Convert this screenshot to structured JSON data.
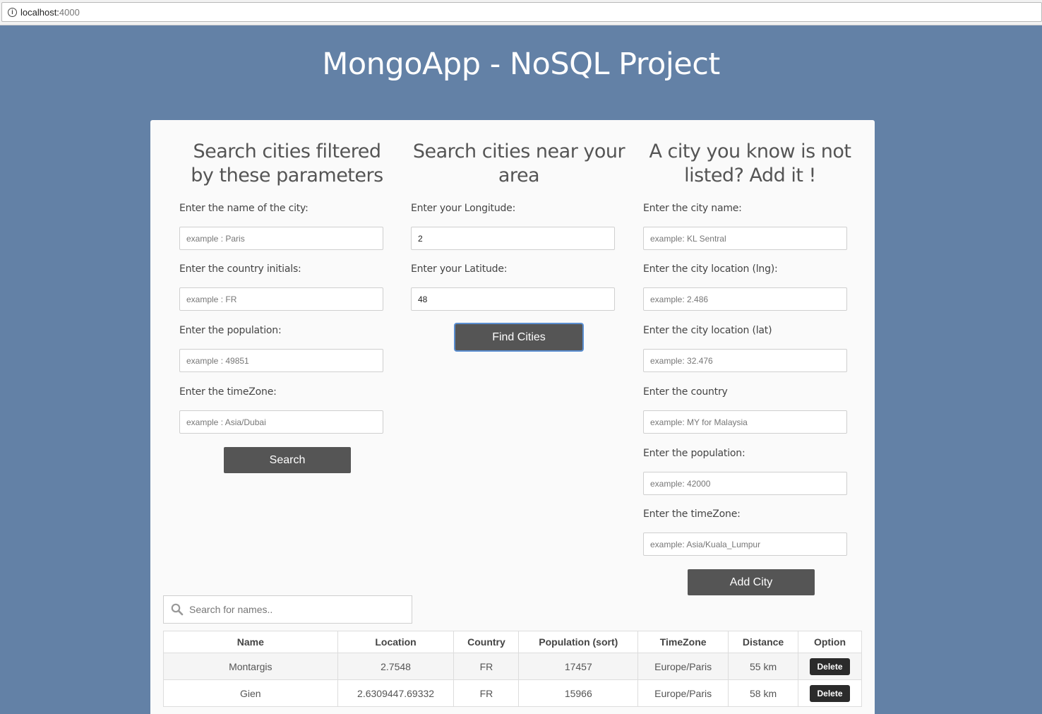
{
  "browser": {
    "url_host": "localhost:",
    "url_port": "4000"
  },
  "app_title": "MongoApp - NoSQL Project",
  "filter_section": {
    "title_line1": "Search cities filtered",
    "title_line2": "by these parameters",
    "name_label": "Enter the name of the city:",
    "name_placeholder": "example : Paris",
    "country_label": "Enter the country initials:",
    "country_placeholder": "example : FR",
    "population_label": "Enter the population:",
    "population_placeholder": "example : 49851",
    "timezone_label": "Enter the timeZone:",
    "timezone_placeholder": "example : Asia/Dubai",
    "search_button": "Search"
  },
  "near_section": {
    "title_line1": "Search cities near your",
    "title_line2": "area",
    "longitude_label": "Enter your Longitude:",
    "longitude_value": "2",
    "latitude_label": "Enter your Latitude:",
    "latitude_value": "48",
    "find_button": "Find Cities"
  },
  "add_section": {
    "title_line1": "A city you know is not",
    "title_line2": "listed? Add it !",
    "name_label": "Enter the city name:",
    "name_placeholder": "example: KL Sentral",
    "lng_label": "Enter the city location (lng):",
    "lng_placeholder": "example: 2.486",
    "lat_label": "Enter the city location (lat)",
    "lat_placeholder": "example: 32.476",
    "country_label": "Enter the country",
    "country_placeholder": "example: MY for Malaysia",
    "population_label": "Enter the population:",
    "population_placeholder": "example: 42000",
    "timezone_label": "Enter the timeZone:",
    "timezone_placeholder": "example: Asia/Kuala_Lumpur",
    "add_button": "Add City"
  },
  "table_search": {
    "placeholder": "Search for names.."
  },
  "table": {
    "headers": [
      "Name",
      "Location",
      "Country",
      "Population (sort)",
      "TimeZone",
      "Distance",
      "Option"
    ],
    "rows": [
      {
        "name": "Montargis",
        "location": "2.7548",
        "country": "FR",
        "population": "17457",
        "timezone": "Europe/Paris",
        "distance": "55 km",
        "option": "Delete"
      },
      {
        "name": "Gien",
        "location": "2.6309447.69332",
        "country": "FR",
        "population": "15966",
        "timezone": "Europe/Paris",
        "distance": "58 km",
        "option": "Delete"
      }
    ]
  }
}
